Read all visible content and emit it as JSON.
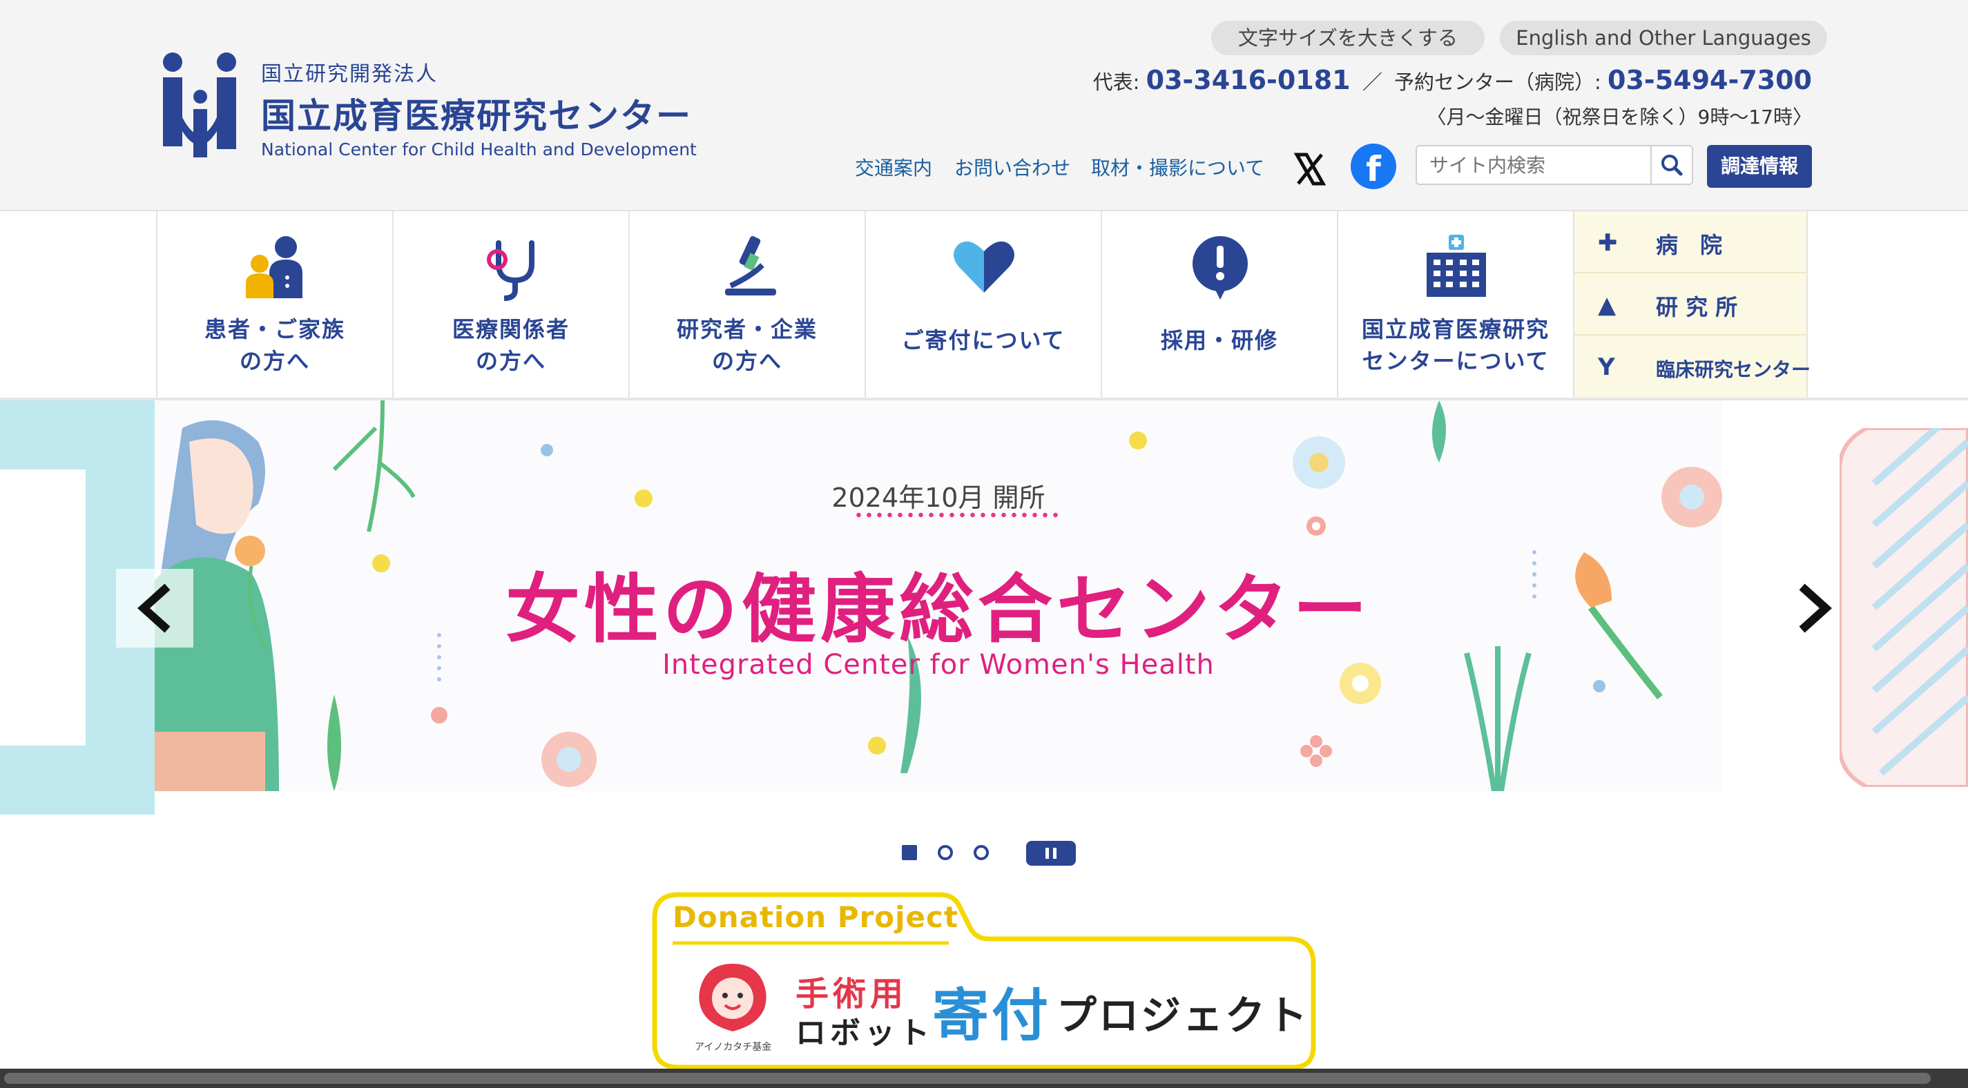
{
  "header": {
    "logo": {
      "org_type": "国立研究開発法人",
      "name_ja": "国立成育医療研究センター",
      "name_en": "National Center for Child Health and Development"
    },
    "text_size_button": "文字サイズを大きくする",
    "languages_button": "English and Other Languages",
    "phone": {
      "main_label": "代表:",
      "main_number": "03-3416-0181",
      "separator": "／",
      "reserve_label": "予約センター（病院）:",
      "reserve_number": "03-5494-7300",
      "hours": "〈月〜金曜日（祝祭日を除く）9時〜17時〉"
    },
    "util_links": [
      "交通案内",
      "お問い合わせ",
      "取材・撮影について"
    ],
    "search_placeholder": "サイト内検索",
    "procurement_button": "調達情報"
  },
  "nav": {
    "items": [
      {
        "line1": "患者・ご家族",
        "line2": "の方へ"
      },
      {
        "line1": "医療関係者",
        "line2": "の方へ"
      },
      {
        "line1": "研究者・企業",
        "line2": "の方へ"
      },
      {
        "line1": "ご寄付について",
        "line2": ""
      },
      {
        "line1": "採用・研修",
        "line2": ""
      },
      {
        "line1": "国立成育医療研究",
        "line2": "センターについて"
      }
    ],
    "side": [
      {
        "label": "病　院"
      },
      {
        "label": "研 究 所"
      },
      {
        "label": "臨床研究センター"
      }
    ]
  },
  "hero": {
    "date": "2024年10月 開所",
    "title": "女性の健康総合センター",
    "subtitle": "Integrated Center for Women's Health",
    "prev_arrow": "‹",
    "next_arrow": "›"
  },
  "carousel": {
    "slide_count": 3,
    "active_index": 0
  },
  "donation": {
    "label": "Donation Project",
    "fund_name": "アイノカタチ基金",
    "part1_line1": "手術用",
    "part1_line2": "ロボット",
    "part2": "寄付",
    "part3": "プロジェクト"
  },
  "colors": {
    "brand_blue": "#2a4594",
    "pink": "#e0207f",
    "donation_yellow": "#f5d800"
  }
}
